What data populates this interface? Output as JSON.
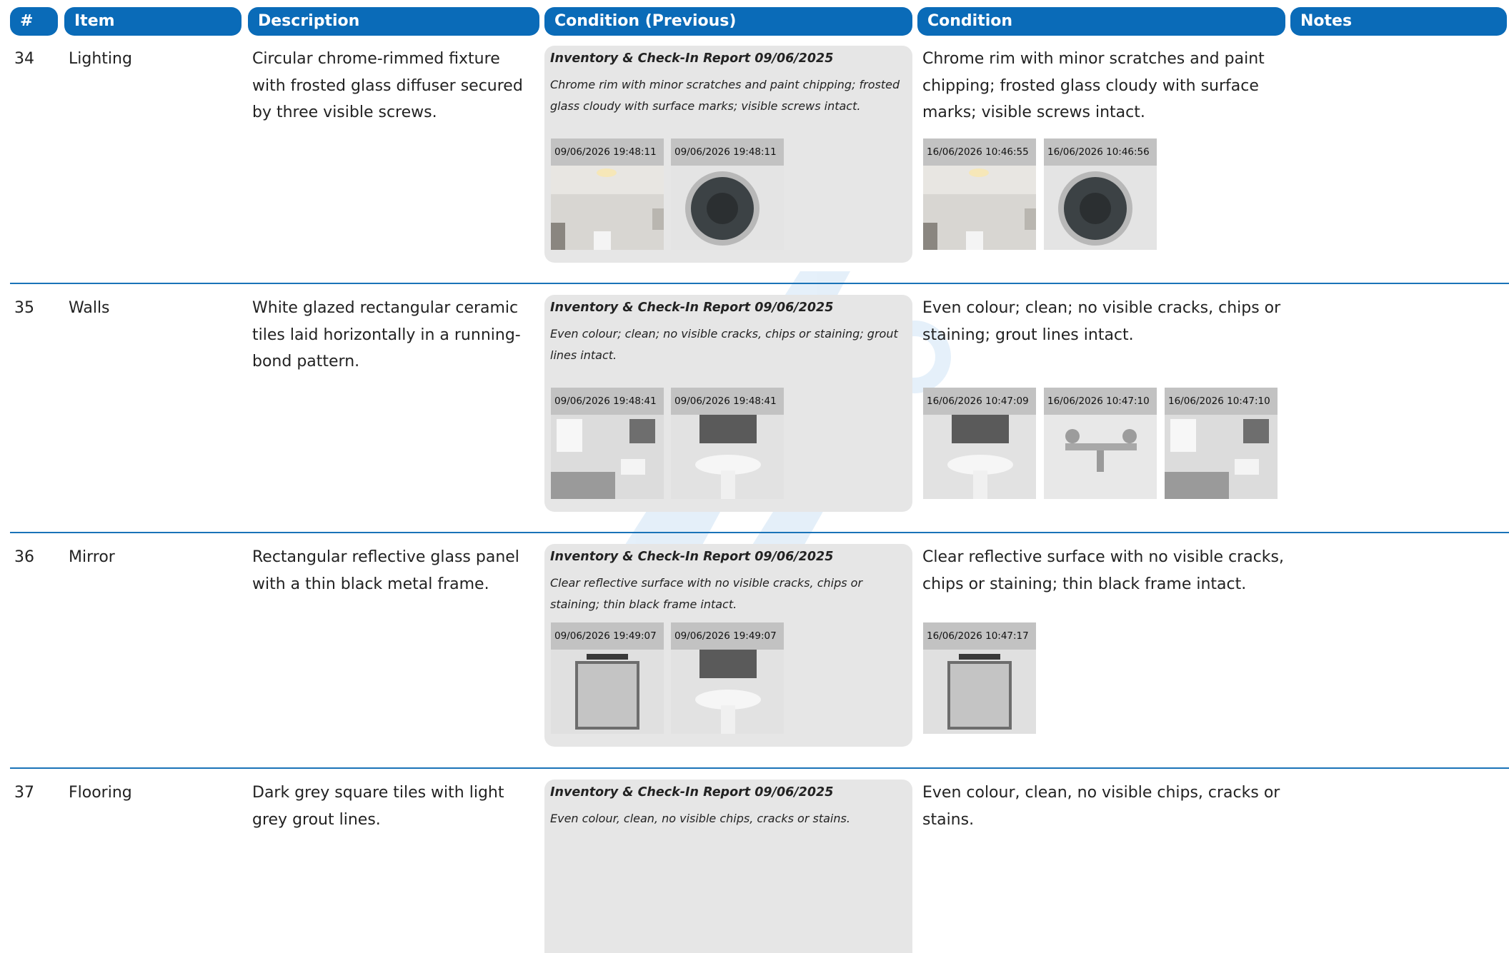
{
  "headers": {
    "num": "#",
    "item": "Item",
    "description": "Description",
    "condition_previous": "Condition (Previous)",
    "condition": "Condition",
    "notes": "Notes"
  },
  "colors": {
    "header_bg": "#0a6bb8",
    "row_separator": "#1a73b8",
    "previous_box_bg": "#e6e6e6"
  },
  "rows": [
    {
      "num": "34",
      "item": "Lighting",
      "description": "Circular chrome-rimmed fixture with frosted glass diffuser secured by three visible screws.",
      "previous_title": "Inventory & Check-In Report 09/06/2025",
      "previous_text": "Chrome rim with minor scratches and paint chipping; frosted glass cloudy with surface marks; visible screws intact.",
      "previous_photos": [
        {
          "timestamp": "09/06/2026 19:48:11",
          "subject": "ceiling-light-room"
        },
        {
          "timestamp": "09/06/2026 19:48:11",
          "subject": "ceiling-light-closeup"
        }
      ],
      "condition": "Chrome rim with minor scratches and paint chipping; frosted glass cloudy with surface marks; visible screws intact.",
      "photos": [
        {
          "timestamp": "16/06/2026 10:46:55",
          "subject": "ceiling-light-room"
        },
        {
          "timestamp": "16/06/2026 10:46:56",
          "subject": "ceiling-light-closeup"
        }
      ],
      "notes": ""
    },
    {
      "num": "35",
      "item": "Walls",
      "description": "White glazed rectangular ceramic tiles laid horizontally in a running-bond pattern.",
      "previous_title": "Inventory & Check-In Report 09/06/2025",
      "previous_text": "Even colour; clean; no visible cracks, chips or staining; grout lines intact.",
      "previous_photos": [
        {
          "timestamp": "09/06/2026 19:48:41",
          "subject": "bathroom-wide"
        },
        {
          "timestamp": "09/06/2026 19:48:41",
          "subject": "basin"
        }
      ],
      "condition": "Even colour; clean; no visible cracks, chips or staining; grout lines intact.",
      "photos": [
        {
          "timestamp": "16/06/2026 10:47:09",
          "subject": "basin"
        },
        {
          "timestamp": "16/06/2026 10:47:10",
          "subject": "bath-tap"
        },
        {
          "timestamp": "16/06/2026 10:47:10",
          "subject": "bathroom-wide"
        }
      ],
      "notes": ""
    },
    {
      "num": "36",
      "item": "Mirror",
      "description": "Rectangular reflective glass panel with a thin black metal frame.",
      "previous_title": "Inventory & Check-In Report 09/06/2025",
      "previous_text": "Clear reflective surface with no visible cracks, chips or staining; thin black frame intact.",
      "previous_photos": [
        {
          "timestamp": "09/06/2026 19:49:07",
          "subject": "mirror"
        },
        {
          "timestamp": "09/06/2026 19:49:07",
          "subject": "basin"
        }
      ],
      "condition": "Clear reflective surface with no visible cracks, chips or staining; thin black frame intact.",
      "photos": [
        {
          "timestamp": "16/06/2026 10:47:17",
          "subject": "mirror"
        }
      ],
      "notes": ""
    },
    {
      "num": "37",
      "item": "Flooring",
      "description": "Dark grey square tiles with light grey grout lines.",
      "previous_title": "Inventory & Check-In Report 09/06/2025",
      "previous_text": "Even colour, clean, no visible chips, cracks or stains.",
      "previous_photos": [],
      "condition": "Even colour, clean, no visible chips, cracks or stains.",
      "photos": [],
      "notes": ""
    }
  ]
}
